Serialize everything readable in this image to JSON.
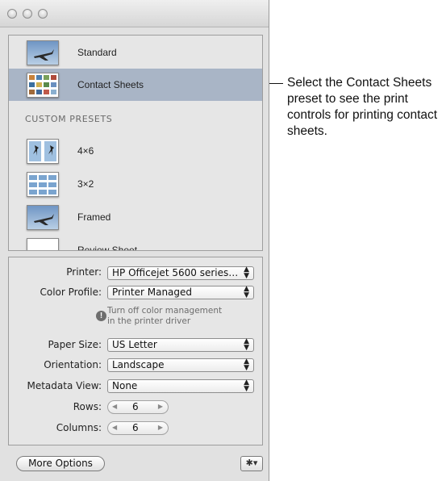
{
  "presets": [
    {
      "label": "Standard",
      "selected": false,
      "thumb": "airplane-photo"
    },
    {
      "label": "Contact Sheets",
      "selected": true,
      "thumb": "contact-sheet-grid"
    }
  ],
  "custom_presets_header": "CUSTOM PRESETS",
  "custom_presets": [
    {
      "label": "4×6",
      "thumb": "two-figures"
    },
    {
      "label": "3×2",
      "thumb": "photo-grid"
    },
    {
      "label": "Framed",
      "thumb": "airplane-photo"
    },
    {
      "label": "Review Sheet",
      "thumb": "blank"
    }
  ],
  "controls": {
    "printer_label": "Printer:",
    "printer_value": "HP Officejet 5600 series…",
    "color_profile_label": "Color Profile:",
    "color_profile_value": "Printer Managed",
    "notice_line1": "Turn off color management",
    "notice_line2": "in the printer driver",
    "notice_icon": "!",
    "paper_size_label": "Paper Size:",
    "paper_size_value": "US Letter",
    "orientation_label": "Orientation:",
    "orientation_value": "Landscape",
    "metadata_view_label": "Metadata View:",
    "metadata_view_value": "None",
    "rows_label": "Rows:",
    "rows_value": "6",
    "columns_label": "Columns:",
    "columns_value": "6"
  },
  "buttons": {
    "more_options": "More Options",
    "gear": "✱▾"
  },
  "callout": "Select the Contact Sheets preset to see the print controls for printing contact sheets.",
  "colors": {
    "selection": "#a9b5c6",
    "panel": "#e6e6e6",
    "window": "#e1e1e1"
  }
}
